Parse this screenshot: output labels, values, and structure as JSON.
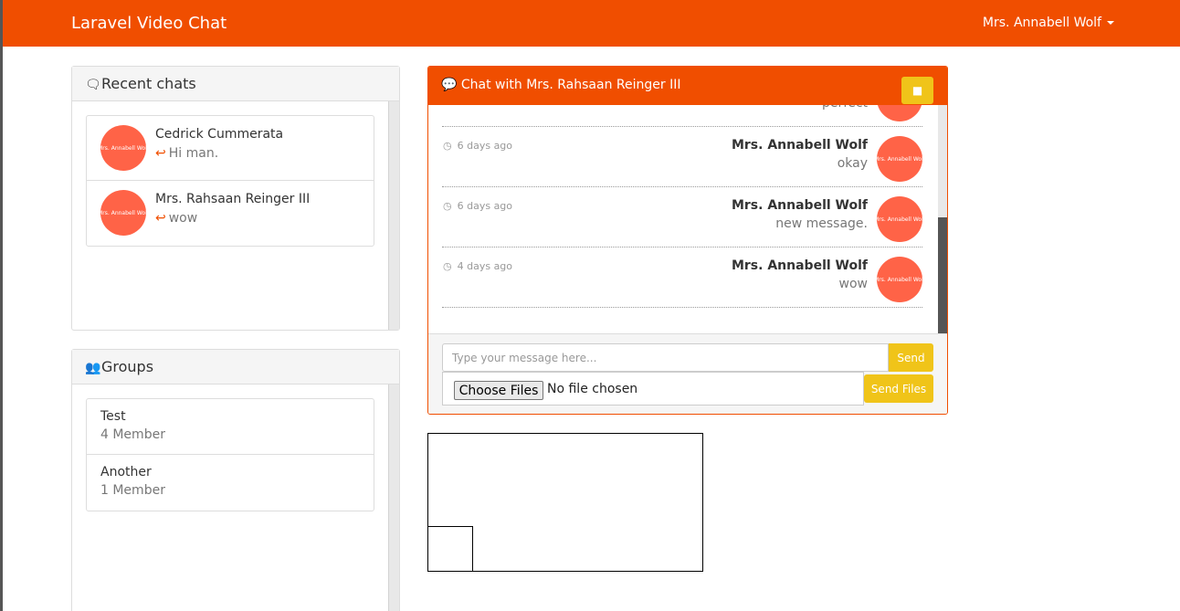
{
  "navbar": {
    "brand": "Laravel Video Chat",
    "user_name": "Mrs. Annabell Wolf"
  },
  "recent_chats": {
    "title": "Recent chats",
    "icon": "comments-icon",
    "items": [
      {
        "name": "Cedrick Cummerata",
        "last_message": "Hi man.",
        "avatar_text": "Mrs. Annabell Wolf"
      },
      {
        "name": "Mrs. Rahsaan Reinger III",
        "last_message": "wow",
        "avatar_text": "Mrs. Annabell Wolf"
      }
    ]
  },
  "groups": {
    "title": "Groups",
    "icon": "users-icon",
    "items": [
      {
        "name": "Test",
        "members": "4 Member"
      },
      {
        "name": "Another",
        "members": "1 Member"
      }
    ]
  },
  "chat": {
    "title": "Chat with Mrs. Rahsaan Reinger III",
    "icon": "comment-icon",
    "partial_message_text": "perfect",
    "messages": [
      {
        "time": "6 days ago",
        "sender": "Mrs. Annabell Wolf",
        "text": "okay",
        "avatar_text": "Mrs. Annabell Wolf"
      },
      {
        "time": "6 days ago",
        "sender": "Mrs. Annabell Wolf",
        "text": "new message.",
        "avatar_text": "Mrs. Annabell Wolf"
      },
      {
        "time": "4 days ago",
        "sender": "Mrs. Annabell Wolf",
        "text": "wow",
        "avatar_text": "Mrs. Annabell Wolf"
      }
    ],
    "input_placeholder": "Type your message here...",
    "send_label": "Send",
    "choose_files_label": "Choose Files",
    "no_file_label": "No file chosen",
    "send_files_label": "Send Files"
  },
  "colors": {
    "brand": "#f04e00",
    "accent": "#f0c419",
    "avatar": "#ff6347"
  }
}
